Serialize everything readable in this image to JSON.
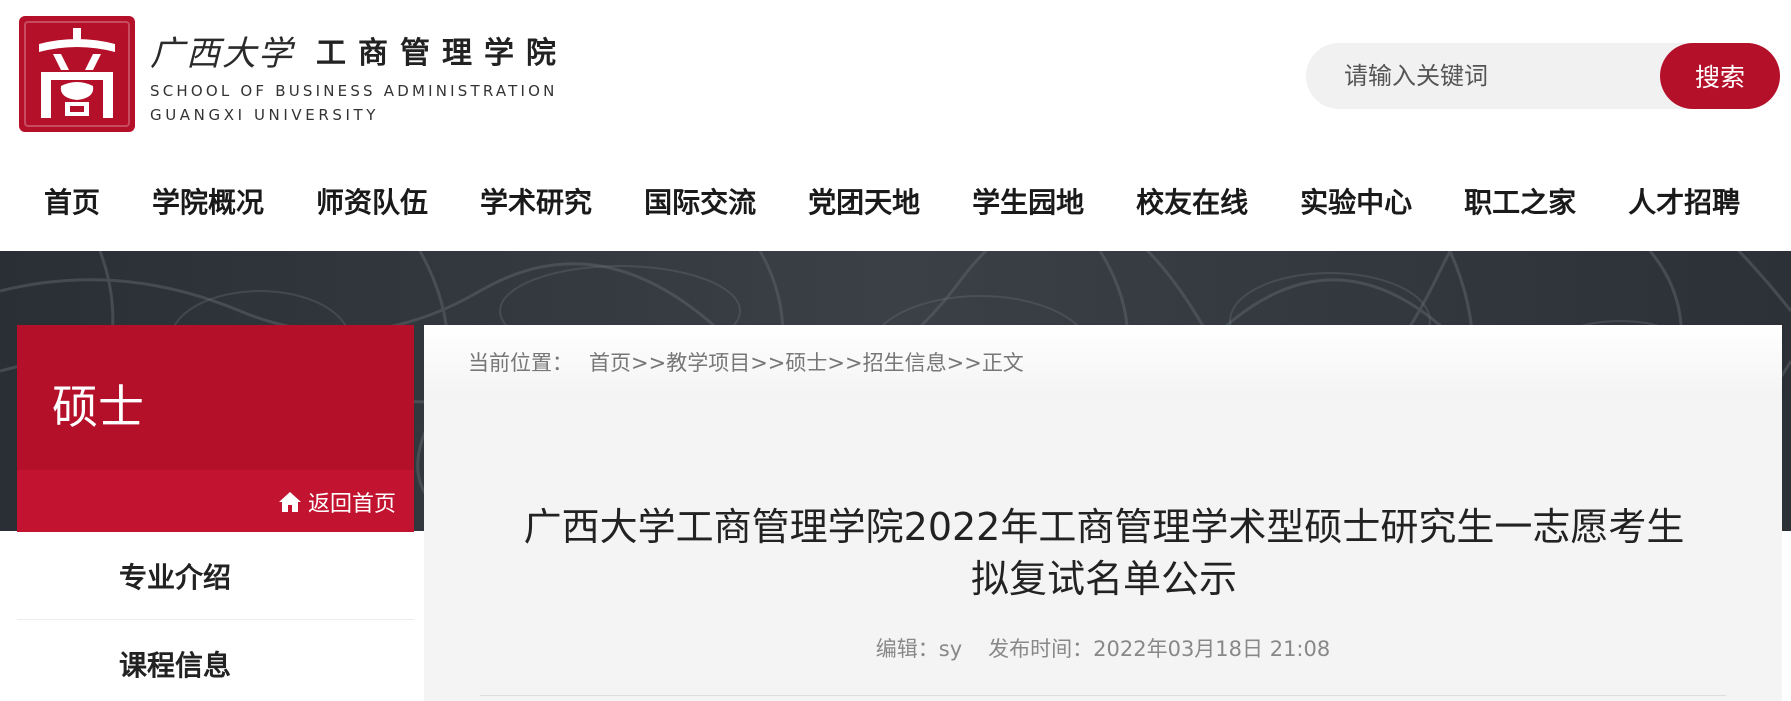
{
  "header": {
    "logo": {
      "seal_char": "商",
      "university_cn": "广西大学",
      "school_cn": "工商管理学院",
      "school_en_line1": "SCHOOL OF BUSINESS ADMINISTRATION",
      "school_en_line2": "GUANGXI UNIVERSITY"
    },
    "search": {
      "placeholder": "请输入关键词",
      "button_label": "搜索"
    }
  },
  "nav": {
    "items": [
      "首页",
      "学院概况",
      "师资队伍",
      "学术研究",
      "国际交流",
      "党团天地",
      "学生园地",
      "校友在线",
      "实验中心",
      "职工之家",
      "人才招聘"
    ]
  },
  "sidebar": {
    "title": "硕士",
    "back_label": "返回首页",
    "items": [
      "专业介绍",
      "课程信息"
    ]
  },
  "breadcrumb": {
    "label": "当前位置：",
    "items": [
      "首页",
      "教学项目",
      "硕士",
      "招生信息",
      "正文"
    ],
    "separator": ">>"
  },
  "article": {
    "title_line1": "广西大学工商管理学院2022年工商管理学术型硕士研究生一志愿考生",
    "title_line2": "拟复试名单公示",
    "editor": "编辑：sy",
    "publish_time": "发布时间：2022年03月18日 21:08"
  },
  "colors": {
    "brand_red": "#b5102a",
    "back_bar_red": "#c21431",
    "banner_dark": "#2e3338",
    "content_bg": "#f4f4f4"
  },
  "icons": [
    "seal-logo-icon",
    "home-icon"
  ]
}
